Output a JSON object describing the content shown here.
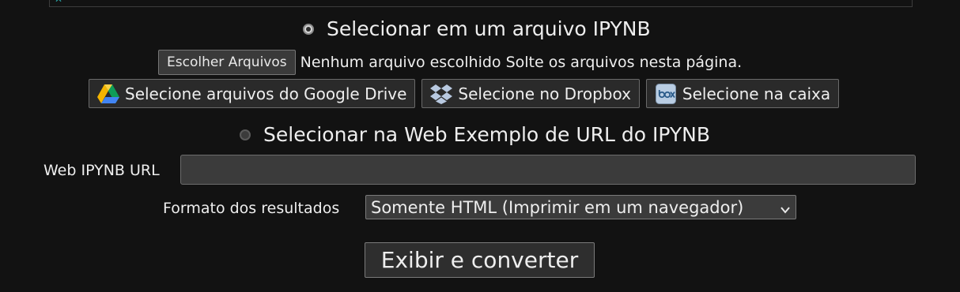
{
  "upload": {
    "radio_label": "Selecionar em um arquivo IPYNB",
    "choose_button": "Escolher Arquivos",
    "file_status": "Nenhum arquivo escolhido Solte os arquivos nesta página.",
    "cloud_buttons": [
      {
        "label": "Selecione arquivos do Google Drive",
        "icon": "google-drive-icon"
      },
      {
        "label": "Selecione no Dropbox",
        "icon": "dropbox-icon"
      },
      {
        "label": "Selecione na caixa",
        "icon": "box-icon"
      }
    ]
  },
  "web": {
    "radio_label": "Selecionar na Web Exemplo de URL do IPYNB",
    "url_label": "Web IPYNB URL",
    "url_value": "",
    "url_placeholder": ""
  },
  "format": {
    "label": "Formato dos resultados",
    "selected": "Somente HTML (Imprimir em um navegador)"
  },
  "submit_label": "Exibir e converter",
  "colors": {
    "background": "#121212",
    "text": "#eeeeee",
    "accent": "#2aa4a6"
  }
}
